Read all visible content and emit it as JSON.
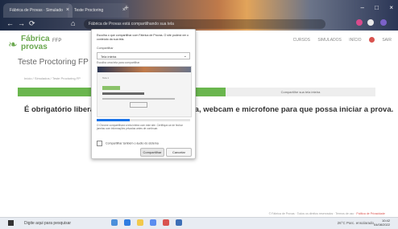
{
  "browser": {
    "tabs": [
      {
        "label": "Fábrica de Provas · Simulado"
      },
      {
        "label": "Teste Proctoring"
      }
    ],
    "new_tab": "+",
    "address": "Fábrica de Provas está compartilhando sua tela",
    "window_controls": {
      "minimize": "–",
      "maximize": "□",
      "close": "×"
    },
    "nav": {
      "back": "←",
      "forward": "→",
      "reload": "⟳",
      "home": "⌂"
    }
  },
  "site": {
    "logo": {
      "leaf": "❧",
      "line1": "Fábrica",
      "line2": "provas",
      "badge": "FFP"
    },
    "topnav": [
      "CURSOS",
      "SIMULADOS",
      "INÍCIO",
      "SAIR"
    ],
    "page_title": "Teste Proctoring FP",
    "breadcrumb": "Início / Simulados / Teste Proctoring FP",
    "step_label": "Compartilhe sua tela inteira",
    "message": "É obrigatório liberar o compartilhamento de tela, webcam e microfone para que possa iniciar a prova.",
    "footer_text": "© Fábrica de Provas · Todos os direitos reservados · Termos de uso ·",
    "footer_link": "Política de Privacidade"
  },
  "share_dialog": {
    "title": "Escolha o que compartilhar com Fábrica de Provas. O site poderá ver o conteúdo da sua tela.",
    "select_label": "Compartilhar",
    "select_value": "Tela inteira",
    "note": "Escolha uma tela para compartilhar",
    "preview_caption": "Tela 1",
    "progress": 0.35,
    "description": "O Chrome compartilhará a tela inteira com este site. Certifique-se de fechar janelas com informações privadas antes de continuar.",
    "checkbox_label": "Compartilhar também o áudio do sistema",
    "buttons": {
      "share": "Compartilhar",
      "cancel": "Cancelar"
    }
  },
  "taskbar": {
    "search": "Digite aqui para pesquisar",
    "tray": "26°C Parc. ensolarado",
    "time": "10:42",
    "date": "04/08/2022"
  }
}
